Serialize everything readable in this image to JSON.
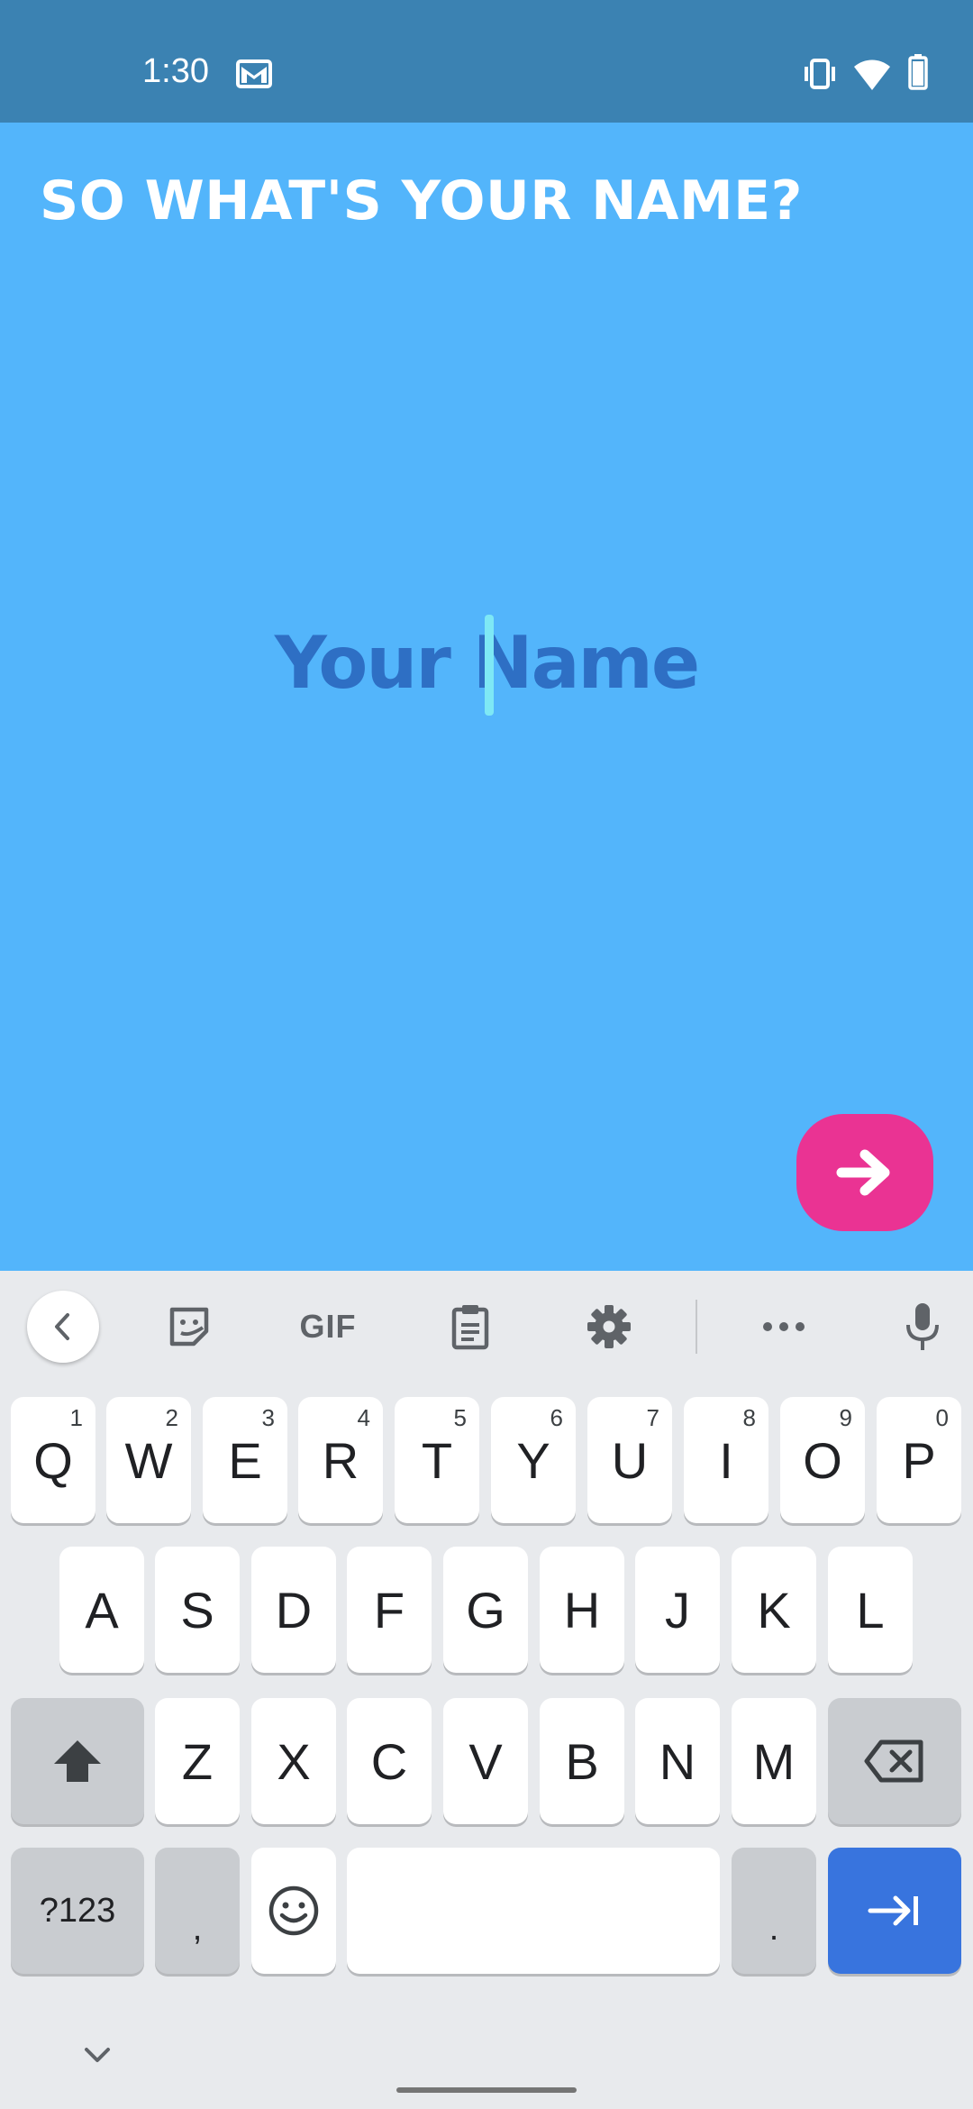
{
  "status_bar": {
    "time": "1:30",
    "icons": [
      "gmail-icon",
      "vibrate-icon",
      "wifi-icon",
      "battery-icon"
    ],
    "color": "#3b82b2"
  },
  "screen": {
    "title": "SO WHAT'S YOUR NAME?",
    "name_input": {
      "placeholder": "Your Name",
      "value": ""
    },
    "next_button": {
      "icon": "arrow-right-icon",
      "color": "#ea3393"
    },
    "background_color": "#53b5fb"
  },
  "keyboard": {
    "toolbar": {
      "items": [
        "back-icon",
        "sticker-icon",
        "GIF",
        "clipboard-icon",
        "settings-icon",
        "more-icon",
        "microphone-icon"
      ],
      "gif_label": "GIF"
    },
    "row1": [
      {
        "label": "Q",
        "hint": "1"
      },
      {
        "label": "W",
        "hint": "2"
      },
      {
        "label": "E",
        "hint": "3"
      },
      {
        "label": "R",
        "hint": "4"
      },
      {
        "label": "T",
        "hint": "5"
      },
      {
        "label": "Y",
        "hint": "6"
      },
      {
        "label": "U",
        "hint": "7"
      },
      {
        "label": "I",
        "hint": "8"
      },
      {
        "label": "O",
        "hint": "9"
      },
      {
        "label": "P",
        "hint": "0"
      }
    ],
    "row2": [
      "A",
      "S",
      "D",
      "F",
      "G",
      "H",
      "J",
      "K",
      "L"
    ],
    "row3": [
      "Z",
      "X",
      "C",
      "V",
      "B",
      "N",
      "M"
    ],
    "row4": {
      "symbols": "?123",
      "comma": ",",
      "period": "."
    },
    "accent_color": "#3874de"
  }
}
